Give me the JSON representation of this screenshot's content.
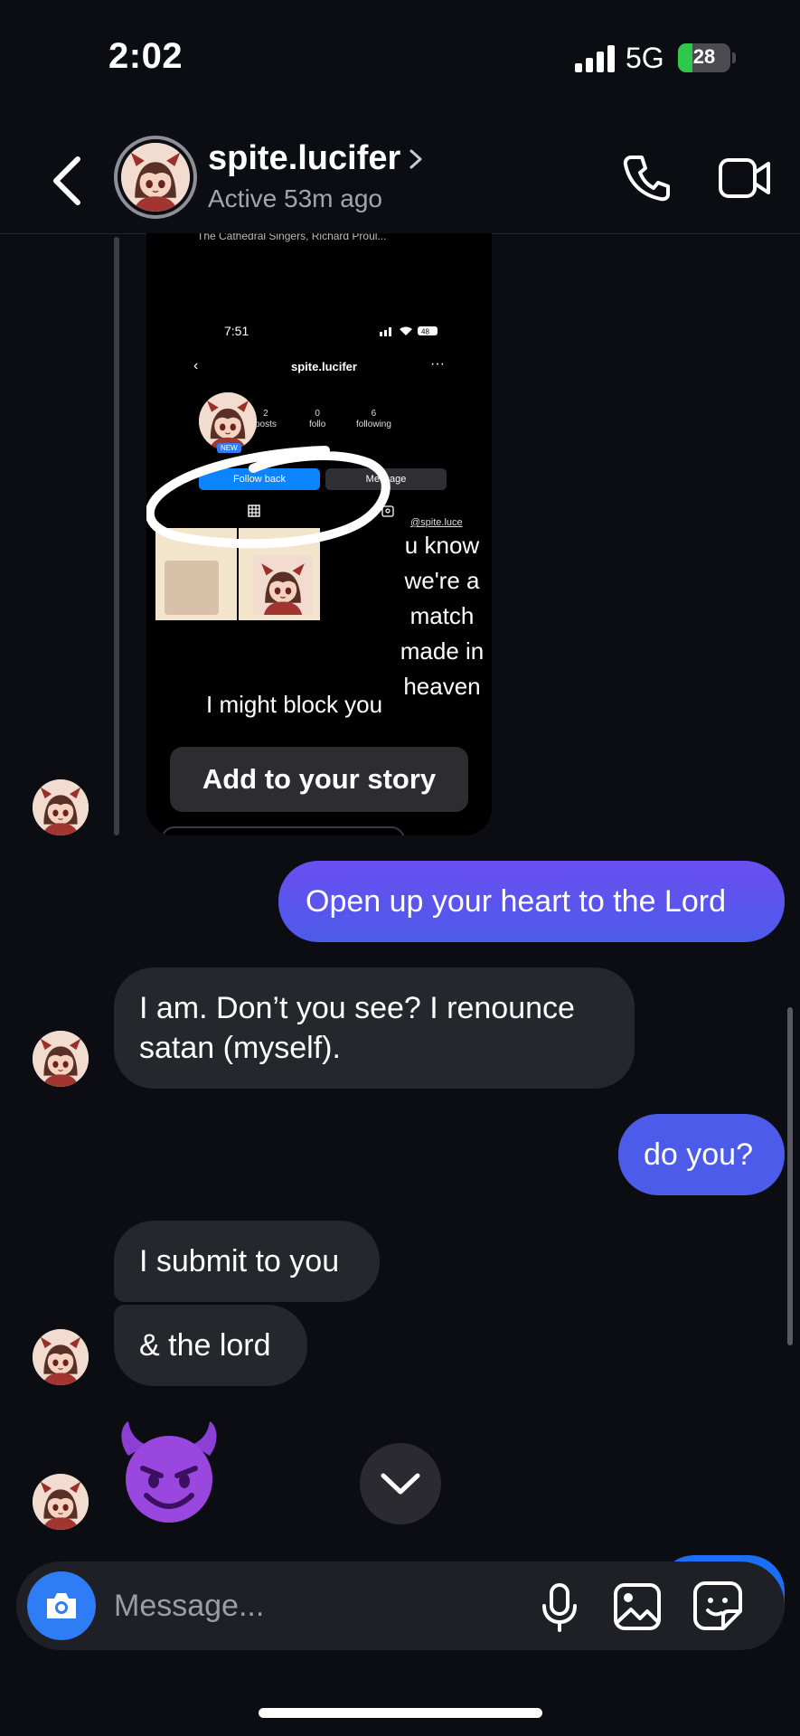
{
  "status_bar": {
    "time": "2:02",
    "network": "5G",
    "battery": "28",
    "battery_level": 0.28
  },
  "header": {
    "username": "spite.lucifer",
    "status": "Active 53m ago"
  },
  "story_reply": {
    "music": "The Cathedral Singers, Richard Proul...",
    "time": "7:51",
    "battery": "48",
    "profile_handle": "spite.lucifer",
    "new_badge": "NEW",
    "posts_count": "2",
    "posts_label": "posts",
    "followers_count": "0",
    "followers_label": "follo",
    "following_count": "6",
    "following_label": "following",
    "follow_back_label": "Follow back",
    "message_label": "Message",
    "tag": "@spite.luce",
    "note": "u know we're a match made in heaven",
    "caption": "I might block you",
    "add_story_label": "Add to your story"
  },
  "messages": [
    {
      "direction": "outgoing",
      "text": "Open up your heart to the Lord"
    },
    {
      "direction": "incoming",
      "text": "I am. Don’t you see? I renounce satan (myself)."
    },
    {
      "direction": "outgoing",
      "text": "do you?"
    },
    {
      "direction": "incoming",
      "text": "I submit to you"
    },
    {
      "direction": "incoming",
      "text": "& the lord"
    },
    {
      "direction": "incoming",
      "emoji": "smiling-devil-face"
    }
  ],
  "composer": {
    "placeholder": "Message..."
  },
  "colors": {
    "outgoing_top": "#6a4ef0",
    "outgoing_bottom": "#4d5bea",
    "incoming": "#26262d",
    "accent": "#2e7cf6"
  }
}
